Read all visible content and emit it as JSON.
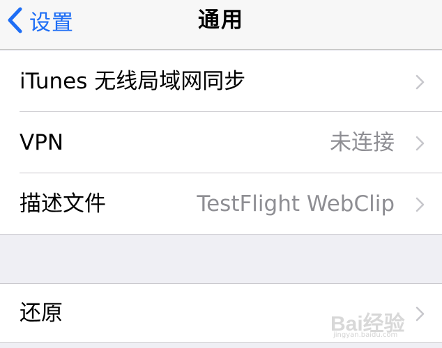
{
  "navbar": {
    "back_label": "设置",
    "title": "通用",
    "back_icon": "chevron-left-icon",
    "accent_color": "#1e6ef5"
  },
  "groups": [
    {
      "rows": [
        {
          "label": "iTunes 无线局域网同步",
          "value": "",
          "icon": "chevron-right-icon"
        },
        {
          "label": "VPN",
          "value": "未连接",
          "icon": "chevron-right-icon"
        },
        {
          "label": "描述文件",
          "value": "TestFlight WebClip",
          "icon": "chevron-right-icon"
        }
      ]
    },
    {
      "rows": [
        {
          "label": "还原",
          "value": "",
          "icon": "chevron-right-icon"
        }
      ]
    }
  ],
  "watermark": {
    "text": "Bai经验",
    "sub": "jingyan.baidu.com"
  }
}
